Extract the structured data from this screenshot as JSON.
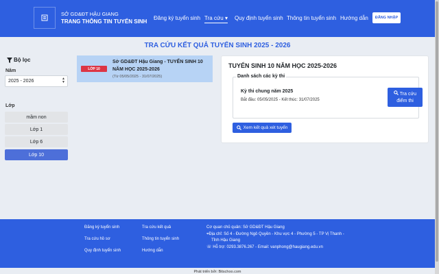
{
  "header": {
    "org": "SỞ GD&ĐT HẬU GIANG",
    "site": "TRANG THÔNG TIN TUYỂN SINH",
    "nav": [
      {
        "label": "Đăng ký tuyển sinh"
      },
      {
        "label": "Tra cứu"
      },
      {
        "label": "Quy định tuyển sinh"
      },
      {
        "label": "Thông tin tuyển sinh"
      },
      {
        "label": "Hướng dẫn"
      }
    ],
    "login": "ĐĂNG NHẬP"
  },
  "page_title": "TRA CỨU KẾT QUẢ TUYỂN SINH 2025 - 2026",
  "sidebar": {
    "filter_title": "Bộ lọc",
    "year_label": "Năm",
    "year_value": "2025 - 2026",
    "level_label": "Lớp",
    "levels": [
      "mầm non",
      "Lớp 1",
      "Lớp 6",
      "Lớp 10"
    ],
    "active_level": "Lớp 10"
  },
  "exam_card": {
    "badge": "LỚP 10",
    "title": "Sở GD&ĐT Hậu Giang - TUYỂN SINH 10 NĂM HỌC 2025-2026",
    "dates": "(Từ 05/05/2025 - 31/07/2025)"
  },
  "panel": {
    "title": "TUYỂN SINH 10 NĂM HỌC 2025-2026",
    "list_title": "Danh sách các kỳ thi",
    "exam_name": "Kỳ thi chung năm 2025",
    "exam_dates": "Bắt đầu: 05/05/2025 - Kết thúc: 31/07/2025",
    "lookup_line1": "Tra cứu",
    "lookup_line2": "điểm thi",
    "results_button": "Xem kết quả xét tuyển"
  },
  "footer": {
    "links_col1": [
      "Đăng ký tuyển sinh",
      "Tra cứu hồ sơ",
      "Quy định tuyển sinh"
    ],
    "links_col2": [
      "Tra cứu kết quả",
      "Thông tin tuyển sinh",
      "Hướng dẫn"
    ],
    "agency": "Cơ quan chủ quản: Sở GD&ĐT Hậu Giang",
    "address_line1": "Địa chỉ: Số 4 - Đường Ngô Quyền - Khu vực 4 - Phường 5 - TP Vị Thanh -",
    "address_line2": "Tỉnh Hậu Giang",
    "support": "Hỗ trợ: 0293.3876.267 - Email: vanphong@haugiang.edu.vn"
  },
  "powered_by": "Phát triển bởi: Bitschoo.com",
  "colors": {
    "primary": "#2e5fe0",
    "badge": "#dc3545",
    "card": "#b7d3f5"
  }
}
